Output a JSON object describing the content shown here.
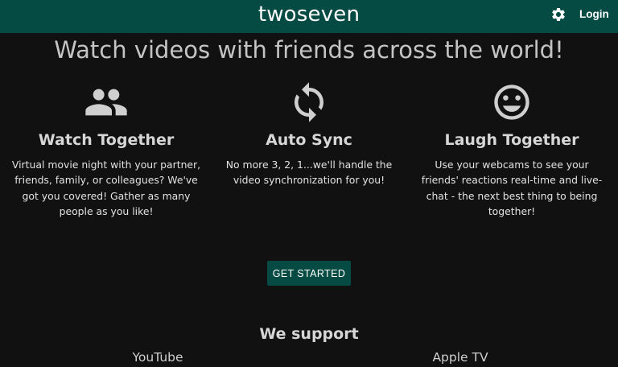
{
  "header": {
    "brand": "twoseven",
    "settings_icon": "gear-icon",
    "login_label": "Login"
  },
  "hero": {
    "title": "Watch videos with friends across the world!"
  },
  "features": [
    {
      "icon": "people-icon",
      "title": "Watch Together",
      "description": "Virtual movie night with your partner, friends, family, or colleagues? We've got you covered! Gather as many people as you like!"
    },
    {
      "icon": "sync-icon",
      "title": "Auto Sync",
      "description": "No more 3, 2, 1...we'll handle the video synchronization for you!"
    },
    {
      "icon": "smiley-icon",
      "title": "Laugh Together",
      "description": "Use your webcams to see your friends' reactions real-time and live-chat - the next best thing to being together!"
    }
  ],
  "cta": {
    "label": "GET STARTED"
  },
  "support": {
    "title": "We support",
    "platforms": [
      "YouTube",
      "Apple TV"
    ]
  },
  "colors": {
    "brand": "#054a43",
    "background": "#111111",
    "icon": "#cfcfcf"
  }
}
